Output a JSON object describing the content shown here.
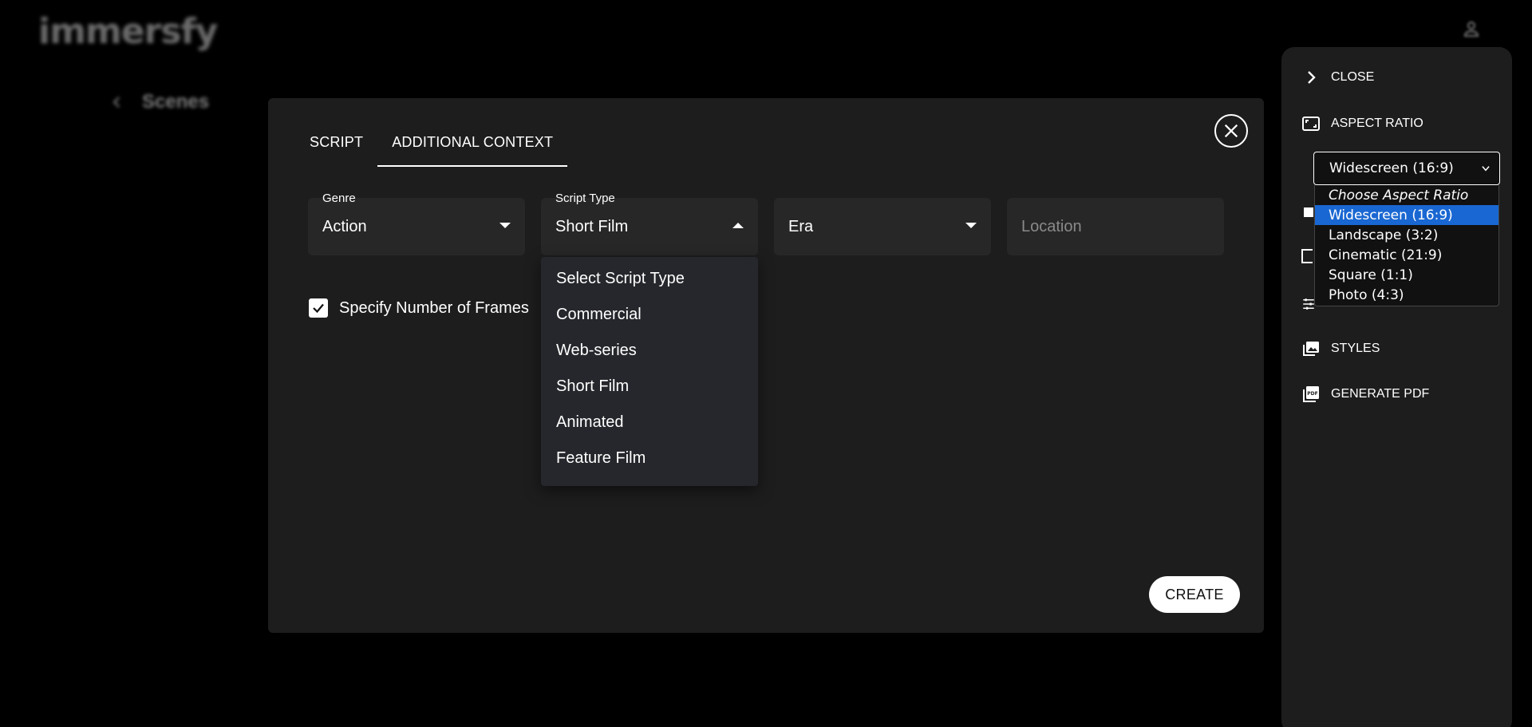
{
  "app": {
    "logo": "immersfy",
    "back_label": "Scenes"
  },
  "modal": {
    "tabs": [
      {
        "label": "SCRIPT",
        "active": false
      },
      {
        "label": "ADDITIONAL CONTEXT",
        "active": true
      }
    ],
    "fields": {
      "genre": {
        "label": "Genre",
        "value": "Action"
      },
      "script_type": {
        "label": "Script Type",
        "value": "Short Film"
      },
      "era": {
        "placeholder": "Era"
      },
      "location": {
        "placeholder": "Location"
      }
    },
    "script_type_options": [
      "Select Script Type",
      "Commercial",
      "Web-series",
      "Short Film",
      "Animated",
      "Feature Film"
    ],
    "specify_frames": {
      "label": "Specify Number of Frames",
      "checked": true
    },
    "create_label": "CREATE"
  },
  "panel": {
    "close_label": "CLOSE",
    "aspect_ratio_label": "ASPECT RATIO",
    "aspect_ratio_selected": "Widescreen (16:9)",
    "aspect_ratio_options": [
      {
        "label": "Choose Aspect Ratio",
        "heading": true
      },
      {
        "label": "Widescreen (16:9)",
        "selected": true
      },
      {
        "label": "Landscape (3:2)"
      },
      {
        "label": "Cinematic (21:9)"
      },
      {
        "label": "Square (1:1)"
      },
      {
        "label": "Photo (4:3)"
      }
    ],
    "styles_label": "STYLES",
    "generate_pdf_label": "GENERATE PDF",
    "selected_highlight_color": "#1967d2"
  }
}
